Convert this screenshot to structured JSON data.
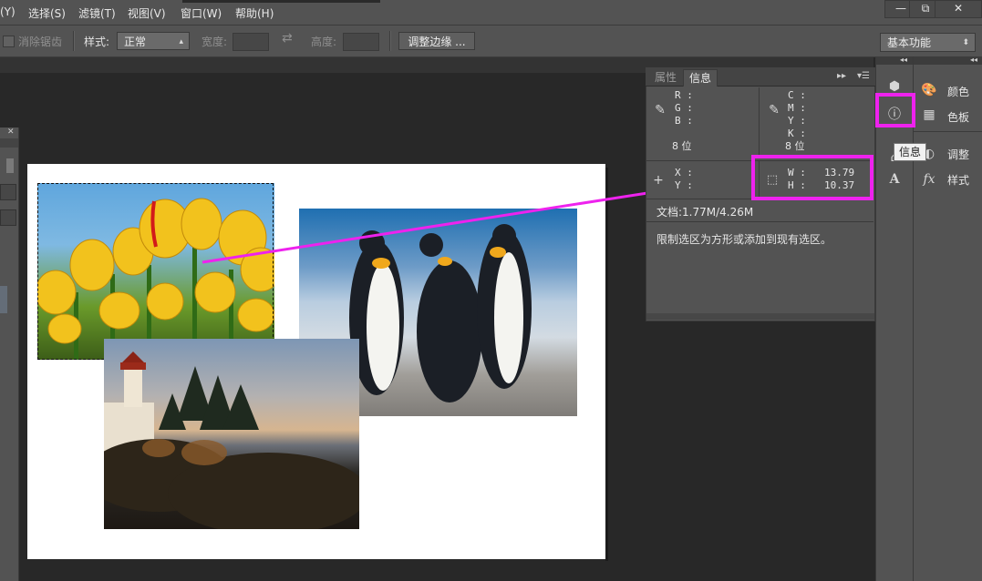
{
  "menu": [
    "(Y)",
    "选择(S)",
    "滤镜(T)",
    "视图(V)",
    "窗口(W)",
    "帮助(H)"
  ],
  "window_controls": {
    "minimize": "—",
    "restore": "⧉",
    "close": "✕"
  },
  "options": {
    "antialias_label": "消除锯齿",
    "style_label": "样式:",
    "style_value": "正常",
    "width_label": "宽度:",
    "swap_icon": "⇄",
    "height_label": "高度:",
    "refine_button": "调整边缘 ...",
    "workspace_value": "基本功能"
  },
  "info_panel": {
    "tabs": [
      "属性",
      "信息"
    ],
    "rgb_text": "R :\nG :\nB :",
    "rgb_bits": "8 位",
    "cmyk_text": "C :\nM :\nY :\nK :",
    "cmyk_bits": "8 位",
    "xy_text": "X :\nY :",
    "w_label": "W :",
    "w_value": "13.79",
    "h_label": "H :",
    "h_value": "10.37",
    "doc_size": "文档:1.77M/4.26M",
    "hint": "限制选区为方形或添加到现有选区。"
  },
  "dock": {
    "items_col2": [
      {
        "label": "颜色",
        "icon": "palette-icon"
      },
      {
        "label": "色板",
        "icon": "grid-icon"
      },
      {
        "label": "调整",
        "icon": "adjust-icon"
      },
      {
        "label": "样式",
        "icon": "fx-icon"
      }
    ],
    "tooltip": "信息"
  },
  "colors": {
    "highlight": "#ee22ee",
    "ui_gray": "#535353",
    "background": "#282828"
  }
}
